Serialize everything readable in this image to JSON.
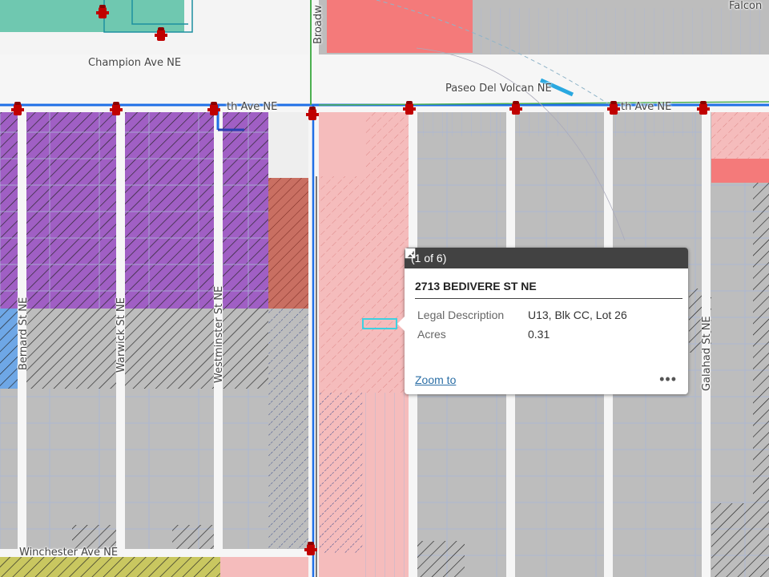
{
  "map": {
    "streets": {
      "champion": "Champion Ave NE",
      "paseo": "Paseo Del Volcan NE",
      "sixth_left": "th Ave NE",
      "sixth_right": "th Ave NE",
      "falcon": "Falcon",
      "broadway": "Broadw",
      "bernard": "Bernard St NE",
      "warwick": "Warwick St NE",
      "westminster": "Westminster St NE",
      "galahad": "Galahad St NE",
      "winchester": "Winchester Ave NE"
    },
    "colors": {
      "background": "#bdbdbd",
      "purple": "#a05fc4",
      "pink": "#f5bcbc",
      "red": "#f47a7a",
      "teal": "#6fc8b0",
      "salmon": "#c96f62",
      "olive": "#c9c760",
      "blue_zone": "#6ea7e6",
      "road": "#f6f6f6",
      "water_line": "#1f6fe6",
      "hydrant": "#c00000"
    }
  },
  "popup": {
    "count": "(1 of 6)",
    "title": "2713 BEDIVERE ST NE",
    "fields": [
      {
        "label": "Legal Description",
        "value": "U13, Blk CC, Lot 26"
      },
      {
        "label": "Acres",
        "value": "0.31"
      }
    ],
    "zoom_label": "Zoom to",
    "more_label": "•••",
    "icons": [
      "play-icon",
      "maximize-icon",
      "close-icon"
    ]
  }
}
